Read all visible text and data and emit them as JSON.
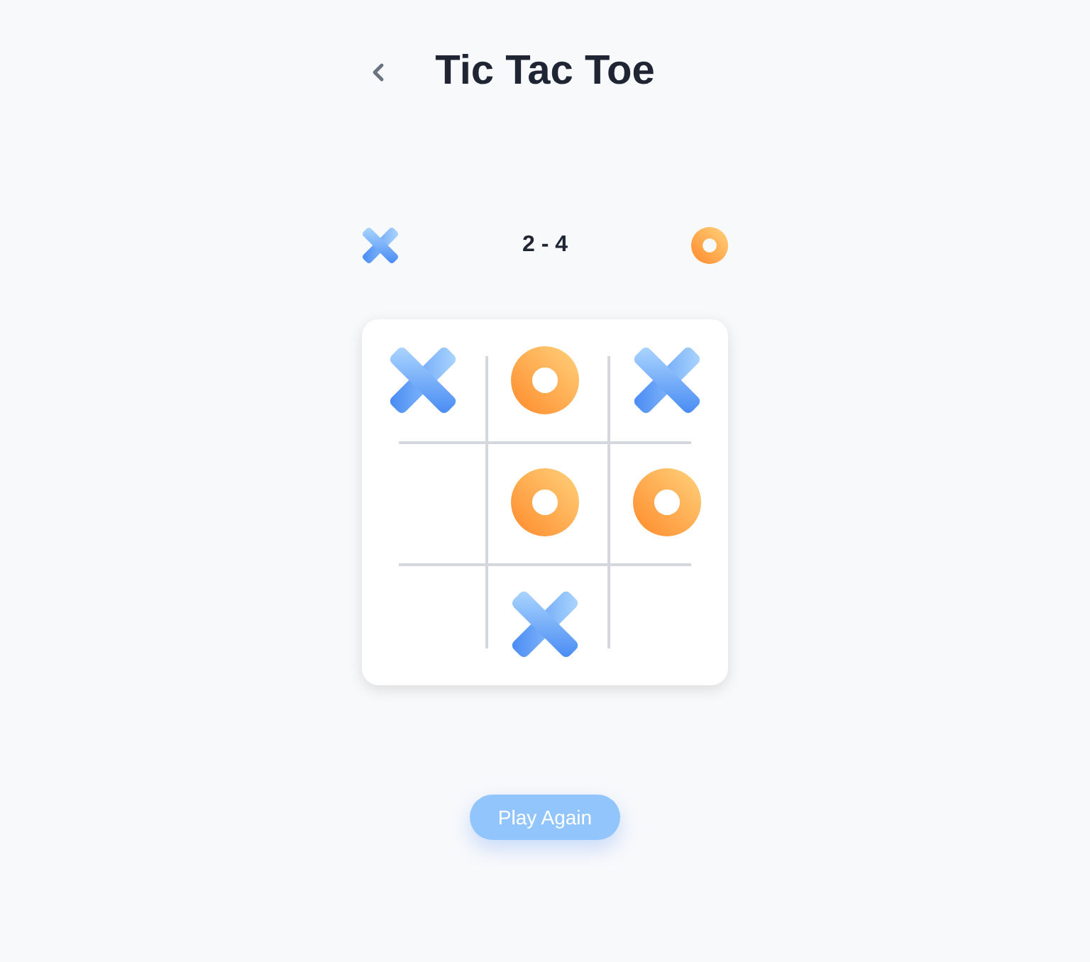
{
  "header": {
    "title": "Tic Tac Toe"
  },
  "score": {
    "text": "2 - 4"
  },
  "board": {
    "cells": [
      {
        "kind": "x"
      },
      {
        "kind": "o"
      },
      {
        "kind": "x"
      },
      {
        "kind": "empty"
      },
      {
        "kind": "o"
      },
      {
        "kind": "o"
      },
      {
        "kind": "empty"
      },
      {
        "kind": "x"
      },
      {
        "kind": "empty"
      }
    ]
  },
  "play_again": {
    "label": "Play Again",
    "disabled": true
  }
}
